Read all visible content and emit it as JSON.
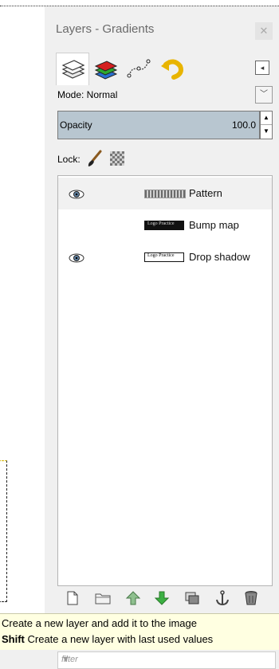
{
  "dock": {
    "title": "Layers - Gradients",
    "close_icon": "close-icon",
    "tabs": [
      {
        "name": "layers-tab",
        "icon": "layers-icon",
        "active": true
      },
      {
        "name": "channels-tab",
        "icon": "channels-icon",
        "active": false
      },
      {
        "name": "paths-tab",
        "icon": "paths-icon",
        "active": false
      },
      {
        "name": "undo-history-tab",
        "icon": "undo-icon",
        "active": false
      }
    ],
    "tab_menu_icon": "tab-menu-icon"
  },
  "mode": {
    "label": "Mode: Normal"
  },
  "opacity": {
    "label": "Opacity",
    "value": "100.0"
  },
  "lock": {
    "label": "Lock:"
  },
  "layers": [
    {
      "name": "Pattern",
      "visible": true,
      "selected": true,
      "thumb_text": ""
    },
    {
      "name": "Bump map",
      "visible": false,
      "selected": false,
      "thumb_text": "Logo Practice"
    },
    {
      "name": "Drop shadow",
      "visible": true,
      "selected": false,
      "thumb_text": "Logo Practice"
    }
  ],
  "toolbar": {
    "buttons": [
      "new-layer-icon",
      "new-layer-group-icon",
      "raise-layer-icon",
      "lower-layer-icon",
      "duplicate-layer-icon",
      "anchor-layer-icon",
      "delete-layer-icon"
    ]
  },
  "tooltip": {
    "line1": "Create a new layer and add it to the image",
    "line2_key": "Shift",
    "line2_text": " Create a new layer with last used values"
  },
  "filter": {
    "placeholder": "filter"
  },
  "colors": {
    "opacity_bar": "#b8c6d0",
    "tooltip_bg": "#ffffe1",
    "panel_bg": "#f0f0f0"
  }
}
